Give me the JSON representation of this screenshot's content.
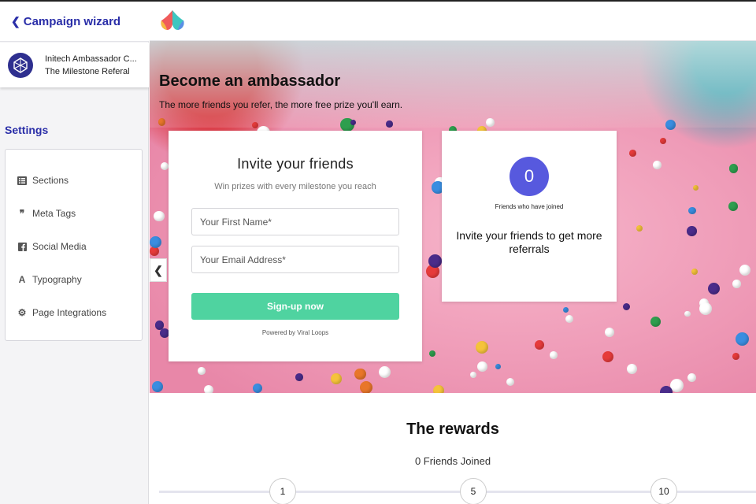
{
  "sidebar": {
    "back_label": "Campaign wizard",
    "campaign": {
      "name": "Initech Ambassador C...",
      "template": "The Milestone Referal"
    },
    "settings_title": "Settings",
    "items": [
      {
        "label": "Sections",
        "icon": "list-icon"
      },
      {
        "label": "Meta Tags",
        "icon": "quote-icon"
      },
      {
        "label": "Social Media",
        "icon": "facebook-icon"
      },
      {
        "label": "Typography",
        "icon": "font-icon"
      },
      {
        "label": "Page Integrations",
        "icon": "gears-icon"
      }
    ]
  },
  "hero": {
    "title": "Become an ambassador",
    "subtitle": "The more friends you refer, the more free prize you'll earn."
  },
  "invite": {
    "title": "Invite your friends",
    "subtitle": "Win prizes with every milestone you reach",
    "first_name_placeholder": "Your First Name*",
    "email_placeholder": "Your Email Address*",
    "button_label": "Sign-up now",
    "powered_by": "Powered by Viral Loops"
  },
  "friends": {
    "count": "0",
    "count_label": "Friends who have joined",
    "message": "Invite your friends to get more referrals"
  },
  "rewards": {
    "title": "The rewards",
    "joined": "0 Friends Joined",
    "milestones": [
      "1",
      "5",
      "10"
    ]
  },
  "colors": {
    "accent": "#2a2ea8",
    "button": "#4fd3a0",
    "counter": "#5759de"
  }
}
